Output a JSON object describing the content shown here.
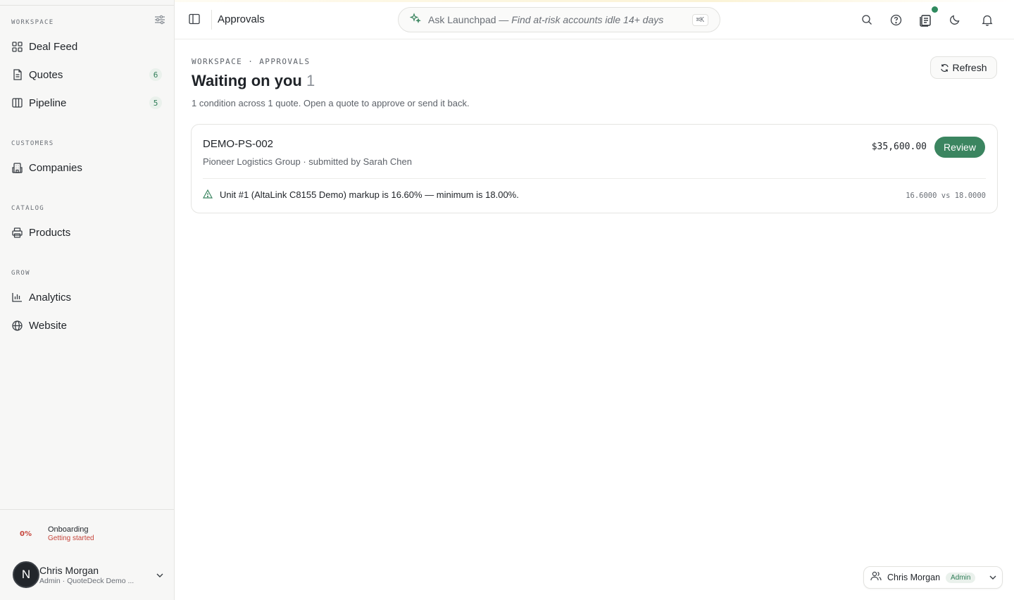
{
  "sidebar": {
    "sections": {
      "workspace": "WORKSPACE",
      "customers": "CUSTOMERS",
      "catalog": "CATALOG",
      "grow": "GROW"
    },
    "items": [
      {
        "label": "Deal Feed",
        "icon": "grid-icon"
      },
      {
        "label": "Quotes",
        "icon": "document-icon",
        "badge": "6"
      },
      {
        "label": "Pipeline",
        "icon": "columns-icon",
        "badge": "5"
      },
      {
        "label": "Companies",
        "icon": "building-icon"
      },
      {
        "label": "Products",
        "icon": "printer-icon"
      },
      {
        "label": "Analytics",
        "icon": "bar-chart-icon"
      },
      {
        "label": "Website",
        "icon": "globe-icon"
      }
    ],
    "onboarding": {
      "percent": "0%",
      "title": "Onboarding",
      "subtitle": "Getting started"
    },
    "user": {
      "initial": "N",
      "name": "Chris Morgan",
      "subtitle": "Admin · QuoteDeck Demo ..."
    }
  },
  "topbar": {
    "title": "Approvals",
    "ask": {
      "prefix": "Ask Launchpad —",
      "hint": "Find at-risk accounts idle 14+ days",
      "shortcut": "⌘K"
    }
  },
  "main": {
    "breadcrumb": "WORKSPACE · APPROVALS",
    "title": "Waiting on you",
    "count": "1",
    "subtitle": "1 condition across 1 quote. Open a quote to approve or send it back.",
    "refresh_label": "Refresh",
    "quote": {
      "id": "DEMO-PS-002",
      "meta": "Pioneer Logistics Group · submitted by Sarah Chen",
      "amount": "$35,600.00",
      "review_label": "Review",
      "condition": "Unit #1 (AltaLink C8155 Demo) markup is 16.60% — minimum is 18.00%.",
      "condition_values": "16.6000 vs 18.0000"
    }
  },
  "footer_user": {
    "name": "Chris Morgan",
    "role": "Admin"
  },
  "colors": {
    "accent": "#3b8560",
    "warning": "#c6443a",
    "badge_bg": "#eaf1ec"
  }
}
